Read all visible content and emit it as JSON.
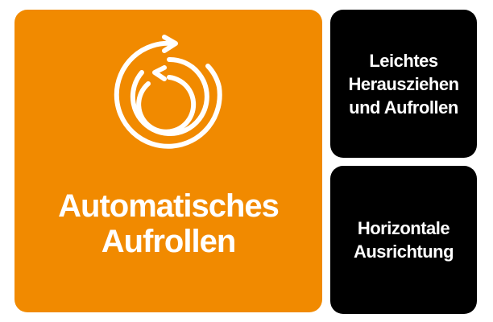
{
  "colors": {
    "main_tile": "#f18a00",
    "side_tile": "#000000",
    "text": "#ffffff"
  },
  "main_tile": {
    "icon": "spiral-rewind-icon",
    "title_lines": [
      "Automatisches",
      "Aufrollen"
    ]
  },
  "side_tiles": [
    {
      "lines": [
        "Leichtes",
        "Herausziehen",
        "und Aufrollen"
      ]
    },
    {
      "lines": [
        "Horizontale",
        "Ausrichtung"
      ]
    }
  ]
}
